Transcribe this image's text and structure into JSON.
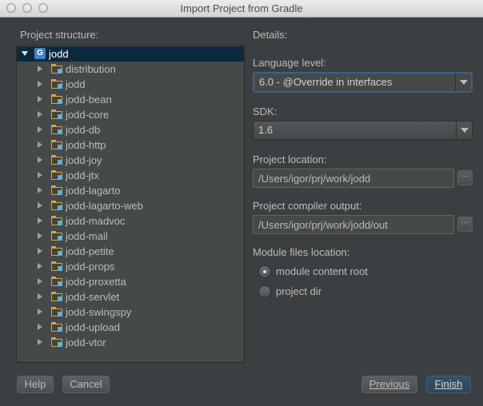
{
  "window": {
    "title": "Import Project from Gradle"
  },
  "left": {
    "heading": "Project structure:",
    "tree": {
      "root": {
        "label": "jodd",
        "icon": "gradle-module-icon"
      },
      "children": [
        "distribution",
        "jodd",
        "jodd-bean",
        "jodd-core",
        "jodd-db",
        "jodd-http",
        "jodd-joy",
        "jodd-jtx",
        "jodd-lagarto",
        "jodd-lagarto-web",
        "jodd-madvoc",
        "jodd-mail",
        "jodd-petite",
        "jodd-props",
        "jodd-proxetta",
        "jodd-servlet",
        "jodd-swingspy",
        "jodd-upload",
        "jodd-vtor"
      ]
    }
  },
  "details": {
    "heading": "Details:",
    "language_level": {
      "label": "Language level:",
      "value": "6.0 - @Override in interfaces"
    },
    "sdk": {
      "label": "SDK:",
      "value": "1.6"
    },
    "project_location": {
      "label": "Project location:",
      "value": "/Users/igor/prj/work/jodd",
      "browse": "···"
    },
    "compiler_output": {
      "label": "Project compiler output:",
      "value": "/Users/igor/prj/work/jodd/out",
      "browse": "···"
    },
    "module_files": {
      "label": "Module files location:",
      "options": [
        "module content root",
        "project dir"
      ],
      "selected": "module content root"
    }
  },
  "buttons": {
    "help": "Help",
    "cancel": "Cancel",
    "previous": "Previous",
    "finish": "Finish"
  },
  "colors": {
    "background": "#3c3f41",
    "selection": "#0d293e",
    "accent": "#3d6185",
    "folder": "#d6a84a"
  }
}
